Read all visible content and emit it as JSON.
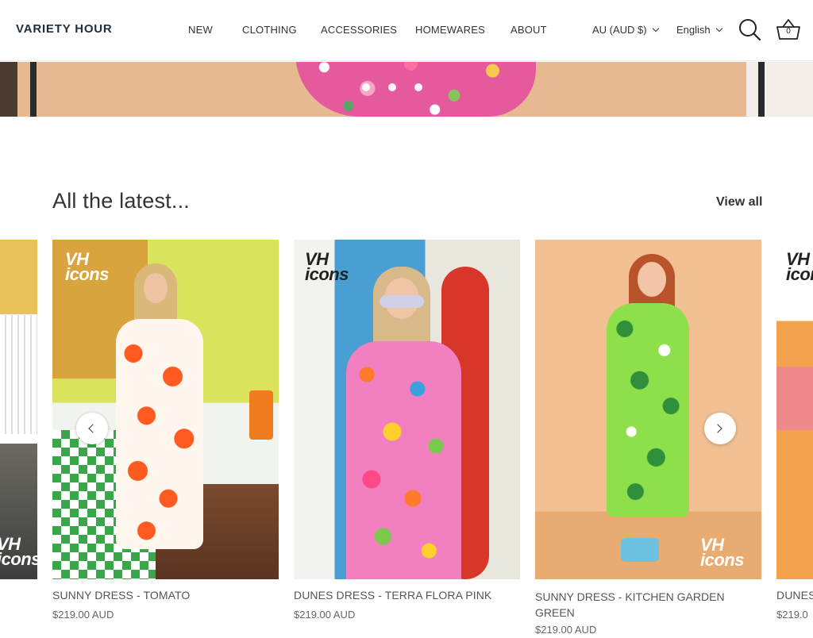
{
  "header": {
    "logo": "VARIETY HOUR",
    "nav": [
      "NEW",
      "CLOTHING",
      "ACCESSORIES",
      "HOMEWARES",
      "ABOUT"
    ],
    "currency": "AU (AUD $)",
    "language": "English",
    "cart_count": "0"
  },
  "hero": {
    "slide_count": 3
  },
  "section": {
    "title": "All the latest...",
    "view_all": "View all"
  },
  "badge": {
    "line1": "VH",
    "line2": "icons"
  },
  "products": [
    {
      "name": "SUNNY DRESS - TOMATO",
      "price": "$219.00 AUD"
    },
    {
      "name": "DUNES DRESS - TERRA FLORA PINK",
      "price": "$219.00 AUD"
    },
    {
      "name": "SUNNY DRESS - KITCHEN GARDEN GREEN",
      "price": "$219.00 AUD"
    },
    {
      "name": "DUNES",
      "price": "$219.0"
    }
  ],
  "colors": {
    "text_dark": "#2b2b2b",
    "logo": "#1f2d3d"
  }
}
